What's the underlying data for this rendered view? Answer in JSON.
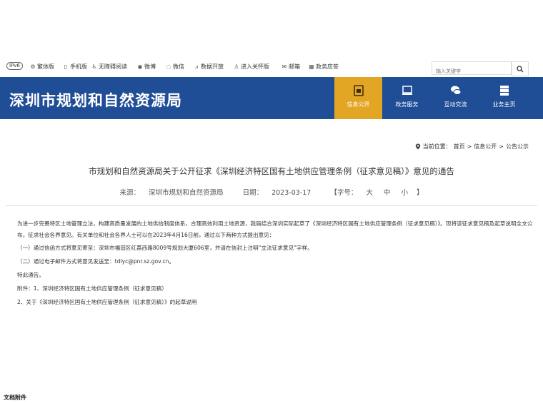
{
  "topbar": {
    "ipv6": "IPv6",
    "traditional": "繁体版",
    "mobile": "手机版",
    "accessible": "无障碍阅读",
    "weibo": "微博",
    "wechat": "微信",
    "open_data": "数据开放",
    "elder": "进入关怀版",
    "mailbox": "邮箱",
    "gov_app": "政务应答",
    "search_placeholder": "输入关键字"
  },
  "header": {
    "site_title": "深圳市规划和自然资源局",
    "nav": [
      {
        "label": "信息公开",
        "icon": "info-doc-icon",
        "active": true
      },
      {
        "label": "政务服务",
        "icon": "monitor-icon",
        "active": false
      },
      {
        "label": "互动交流",
        "icon": "chat-icon",
        "active": false
      },
      {
        "label": "业务主页",
        "icon": "server-icon",
        "active": false
      }
    ],
    "colors": {
      "bar": "#1f4d96",
      "active": "#e3a524"
    }
  },
  "breadcrumb": {
    "prefix": "当前位置：",
    "home": "首页",
    "sep1": ">",
    "level1": "信息公开",
    "sep2": ">",
    "level2": "公告公示"
  },
  "article": {
    "title": "市规划和自然资源局关于公开征求《深圳经济特区国有土地供应管理条例（征求意见稿）》意见的通告",
    "source_label": "来源：",
    "source": "深圳市规划和自然资源局",
    "date_label": "日期：",
    "date": "2023-03-17",
    "font_label": "【字号：",
    "font_large": "大",
    "font_medium": "中",
    "font_small": "小",
    "font_close": "】",
    "paragraphs": [
      "为进一步完善特区土地管理立法，构建高质量发展的土地供给制度体系，合理高效利用土地资源，我局结合深圳实际起草了《深圳经济特区国有土地供应管理条例（征求意见稿）》。现将该征求意见稿及起草说明全文公布，征求社会各界意见。有关单位和社会各界人士可以在2023年4月16日前，通过以下两种方式提出意见：",
      "（一）通过信函方式将意见寄至：深圳市福田区红荔西路8009号规划大厦606室，并请在信封上注明“立法征求意见”字样。",
      "（二）通过电子邮件方式将意见发送至：tdlyc@pnr.sz.gov.cn。",
      "特此通告。",
      "附件：1、深圳经济特区国有土地供应管理条例（征求意见稿）",
      "2、关于《深圳经济特区国有土地供应管理条例（征求意见稿）》的起草说明"
    ],
    "footer_cut": "文档附件"
  }
}
